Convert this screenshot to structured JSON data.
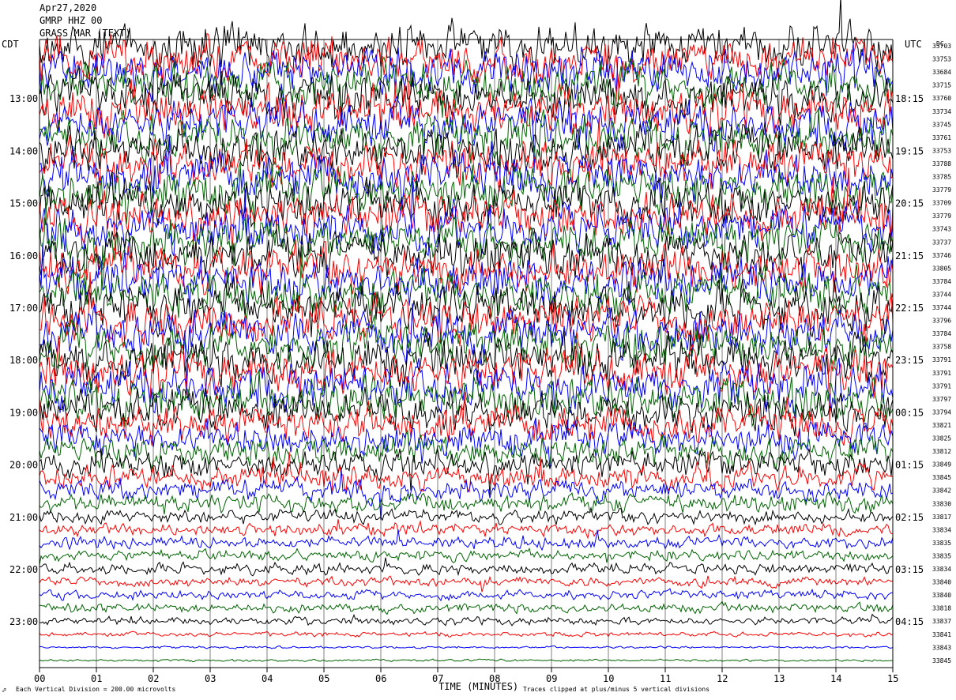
{
  "header": {
    "date": "Apr27,2020",
    "line2": "GMRP HHZ 00",
    "line3": "GRASS MAR (TEXT)"
  },
  "left_zone": "CDT",
  "right_zone": "UTC",
  "dc_label": "DC",
  "footer": {
    "xlabel": "TIME (MINUTES)",
    "scale_note": "Each Vertical Division =  200.00 microvolts",
    "clip_note": "Traces clipped at plus/minus 5 vertical divisions"
  },
  "colors": {
    "trace_cycle": [
      "#ff0000",
      "#0000ff",
      "#006400",
      "#000000"
    ],
    "axis": "#000000",
    "background": "#ffffff"
  },
  "chart_data": {
    "type": "helicorder",
    "xlim": [
      0,
      15
    ],
    "x_ticks": [
      "00",
      "01",
      "02",
      "03",
      "04",
      "05",
      "06",
      "07",
      "08",
      "09",
      "10",
      "11",
      "12",
      "13",
      "14",
      "15"
    ],
    "left_time_labels": [
      "13:00",
      "14:00",
      "15:00",
      "16:00",
      "17:00",
      "18:00",
      "19:00",
      "20:00",
      "21:00",
      "22:00",
      "23:00"
    ],
    "right_time_labels": [
      "18:15",
      "19:15",
      "20:15",
      "21:15",
      "22:15",
      "23:15",
      "00:15",
      "01:15",
      "02:15",
      "03:15",
      "04:15"
    ],
    "dc_values": [
      "33703",
      "33753",
      "33684",
      "33715",
      "33760",
      "33734",
      "33745",
      "33761",
      "33753",
      "33788",
      "33785",
      "33779",
      "33709",
      "33779",
      "33743",
      "33737",
      "33746",
      "33805",
      "33784",
      "33744",
      "33744",
      "33796",
      "33784",
      "33758",
      "33791",
      "33791",
      "33791",
      "33797",
      "33794",
      "33821",
      "33825",
      "33812",
      "33849",
      "33845",
      "33842",
      "33830",
      "33817",
      "33834",
      "33835",
      "33835",
      "33834",
      "33840",
      "33840",
      "33818",
      "33837",
      "33841",
      "33843",
      "33845"
    ],
    "row_amplitude": [
      30,
      30,
      30,
      30,
      30,
      30,
      30,
      30,
      30,
      30,
      30,
      30,
      30,
      30,
      30,
      30,
      30,
      30,
      30,
      30,
      30,
      30,
      30,
      30,
      30,
      30,
      30,
      30,
      26,
      24,
      22,
      20,
      18,
      16,
      14,
      12,
      9,
      8,
      8,
      7,
      7,
      6,
      6,
      6,
      5,
      3,
      1.5,
      1.5
    ],
    "color_order": [
      "black",
      "red",
      "blue",
      "green"
    ]
  }
}
